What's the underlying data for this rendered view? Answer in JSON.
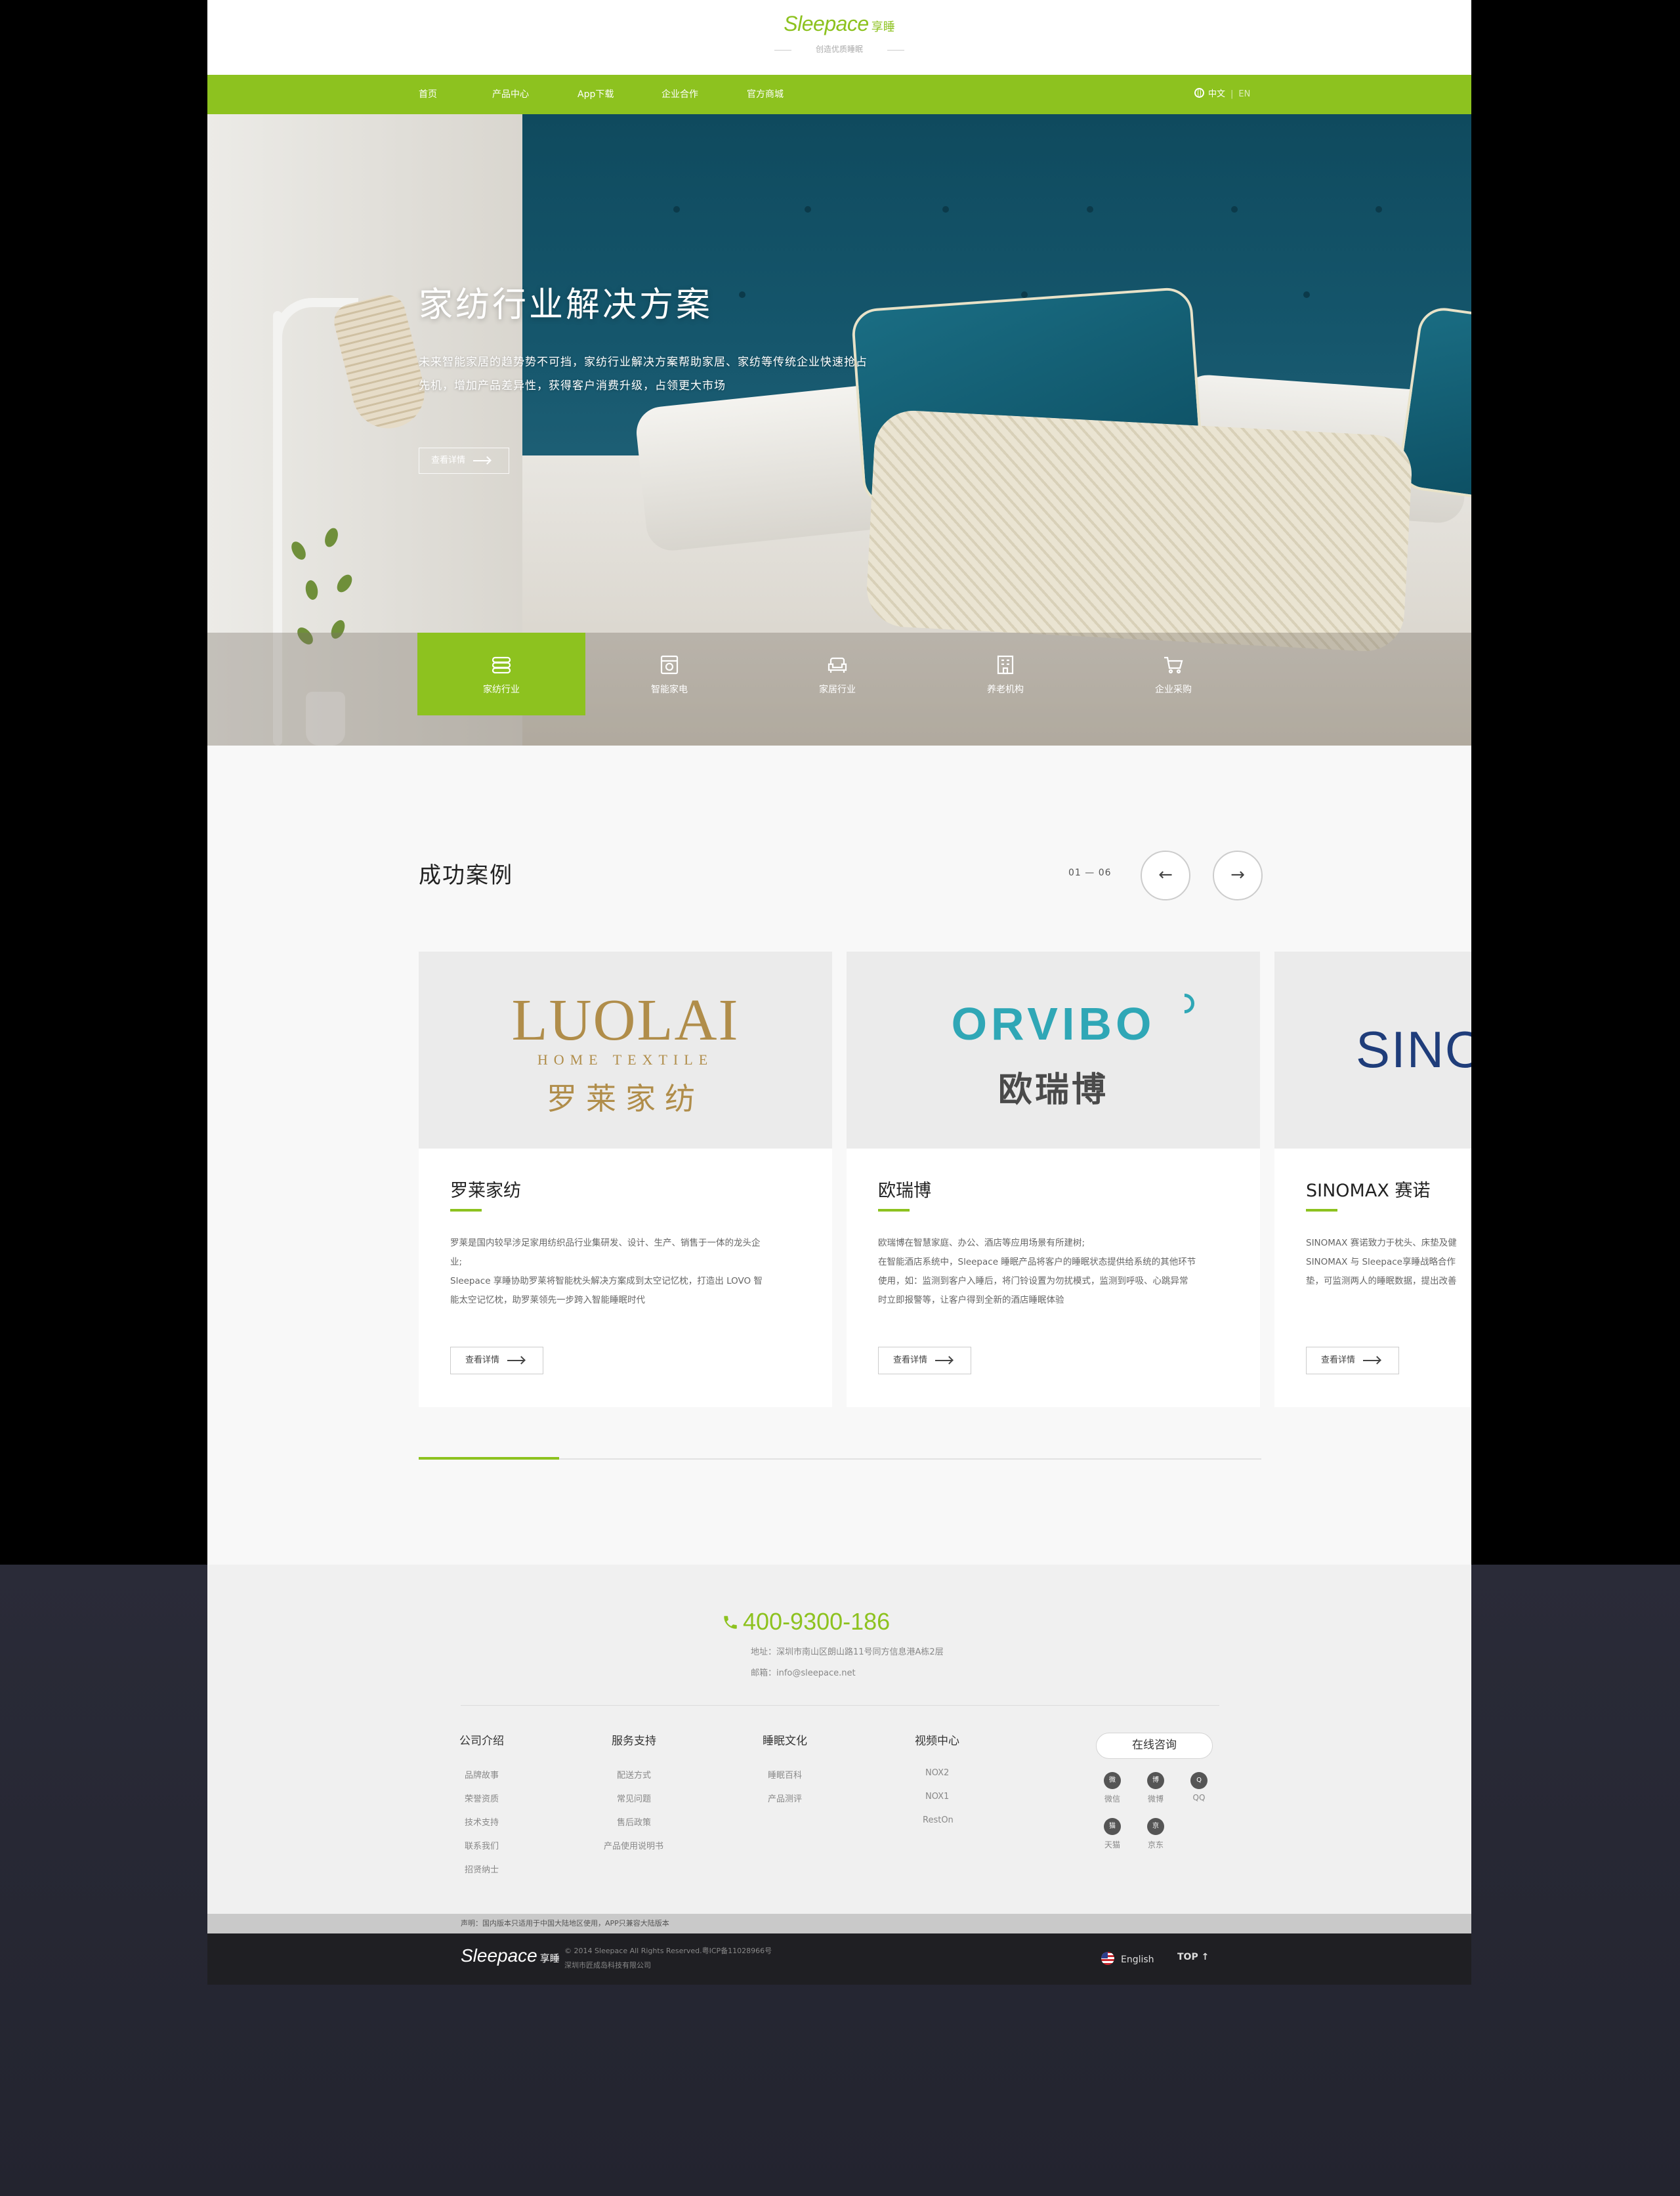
{
  "header": {
    "brand": "Sleepace",
    "brand_cn": "享睡",
    "tagline": "创造优质睡眠"
  },
  "nav": {
    "items": [
      "首页",
      "产品中心",
      "App下载",
      "企业合作",
      "官方商城"
    ],
    "lang_cn": "中文",
    "lang_sep": "|",
    "lang_en": "EN"
  },
  "hero": {
    "title": "家纺行业解决方案",
    "desc_line1": "未来智能家居的趋势势不可挡，家纺行业解决方案帮助家居、家纺等传统企业快速抢占",
    "desc_line2": "先机，增加产品差异性，获得客户消费升级，占领更大市场",
    "button": "查看详情",
    "tabs": [
      {
        "label": "家纺行业",
        "icon": "layers-icon",
        "active": true
      },
      {
        "label": "智能家电",
        "icon": "appliance-icon",
        "active": false
      },
      {
        "label": "家居行业",
        "icon": "sofa-icon",
        "active": false
      },
      {
        "label": "养老机构",
        "icon": "building-icon",
        "active": false
      },
      {
        "label": "企业采购",
        "icon": "cart-icon",
        "active": false
      }
    ]
  },
  "cases": {
    "title": "成功案例",
    "pager": "01 — 06",
    "prev_icon": "←",
    "next_icon": "→",
    "items": [
      {
        "logo_main": "LUOLAI",
        "logo_sub": "HOME TEXTILE",
        "logo_cn": "罗莱家纺",
        "name": "罗莱家纺",
        "desc": [
          "罗莱是国内较早涉足家用纺织品行业集研发、设计、生产、销售于一体的龙头企",
          "业;",
          "Sleepace 享睡协助罗莱将智能枕头解决方案成到太空记忆枕，打造出 LOVO 智",
          "能太空记忆枕，助罗莱领先一步跨入智能睡眠时代"
        ],
        "button": "查看详情"
      },
      {
        "logo_main": "ORVIBO",
        "logo_cn": "欧瑞博",
        "name": "欧瑞博",
        "desc": [
          "欧瑞博在智慧家庭、办公、酒店等应用场景有所建树;",
          "在智能酒店系统中，Sleepace 睡眠产品将客户的睡眠状态提供给系统的其他环节",
          "使用，如：监测到客户入睡后，将门铃设置为勿扰模式，监测到呼吸、心跳异常",
          "时立即报警等，让客户得到全新的酒店睡眠体验"
        ],
        "button": "查看详情"
      },
      {
        "logo_main": "SINO",
        "name": "SINOMAX 赛诺",
        "desc": [
          "SINOMAX 赛诺致力于枕头、床垫及健",
          "SINOMAX 与 Sleepace享睡战略合作",
          "垫，可监测两人的睡眠数据，提出改善"
        ],
        "button": "查看详情"
      }
    ],
    "progress": 0.1667
  },
  "footer": {
    "phone": "400-9300-186",
    "address": "地址：深圳市南山区朗山路11号同方信息港A栋2层",
    "email": "邮箱：info@sleepace.net",
    "columns": [
      {
        "title": "公司介绍",
        "links": [
          "品牌故事",
          "荣誉资质",
          "技术支持",
          "联系我们",
          "招贤纳士"
        ]
      },
      {
        "title": "服务支持",
        "links": [
          "配送方式",
          "常见问题",
          "售后政策",
          "产品使用说明书"
        ]
      },
      {
        "title": "睡眠文化",
        "links": [
          "睡眠百科",
          "产品测评"
        ]
      },
      {
        "title": "视频中心",
        "links": [
          "NOX2",
          "NOX1",
          "RestOn"
        ]
      }
    ],
    "consult": "在线咨询",
    "social": [
      {
        "label": "微信",
        "icon": "wechat-icon",
        "glyph": "微"
      },
      {
        "label": "微博",
        "icon": "weibo-icon",
        "glyph": "博"
      },
      {
        "label": "QQ",
        "icon": "qq-icon",
        "glyph": "Q"
      },
      {
        "label": "天猫",
        "icon": "tmall-icon",
        "glyph": "猫"
      },
      {
        "label": "京东",
        "icon": "jd-icon",
        "glyph": "京"
      }
    ],
    "disclaimer": "声明：国内版本只适用于中国大陆地区使用，APP只兼容大陆版本",
    "bottom_brand": "Sleepace",
    "bottom_brand_cn": "享睡",
    "copyright_line1": "© 2014 Sleepace All Rights Reserved.粤ICP备11028966号",
    "copyright_line2": "深圳市匠成岛科技有限公司",
    "language": "English",
    "top": "TOP ↑"
  },
  "colors": {
    "accent": "#8dc21f",
    "dark_bg": "#23242f",
    "footer_bg": "#f0f0f0"
  }
}
